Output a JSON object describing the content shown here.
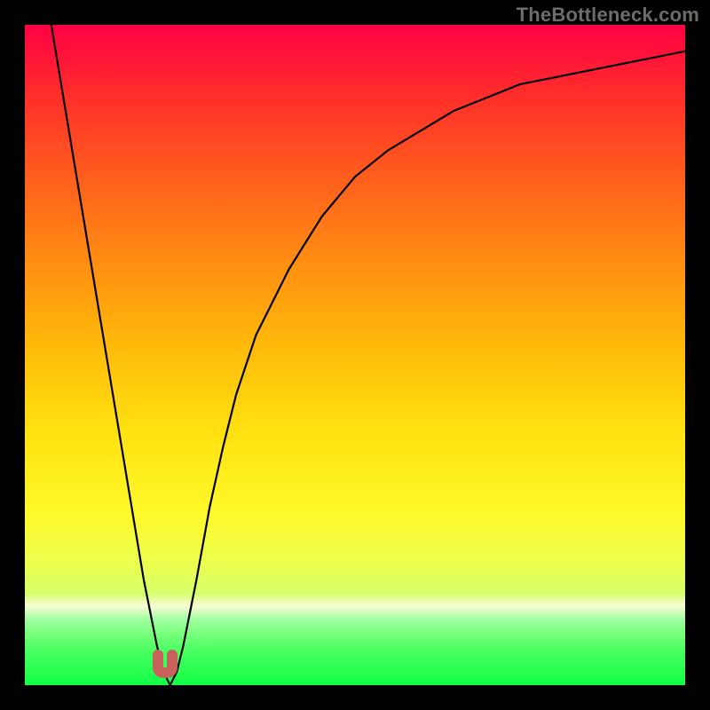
{
  "watermark": {
    "text": "TheBottleneck.com"
  },
  "colors": {
    "background": "#000000",
    "gradient_top": "#ff0044",
    "gradient_mid": "#ffe210",
    "gradient_bottom": "#12ff46",
    "curve": "#000000",
    "marker": "#c9615a"
  },
  "chart_data": {
    "type": "line",
    "title": "",
    "xlabel": "",
    "ylabel": "",
    "xlim": [
      0,
      100
    ],
    "ylim": [
      0,
      100
    ],
    "grid": false,
    "legend": null,
    "annotations": [],
    "series": [
      {
        "name": "curve",
        "x": [
          4,
          6,
          8,
          10,
          12,
          14,
          16,
          18,
          20,
          21,
          22,
          23,
          24,
          26,
          28,
          30,
          32,
          35,
          40,
          45,
          50,
          55,
          60,
          65,
          70,
          75,
          80,
          85,
          90,
          95,
          100
        ],
        "y": [
          100,
          88,
          76,
          64,
          52,
          40,
          28,
          16,
          6,
          2,
          0,
          2,
          6,
          16,
          27,
          36,
          44,
          53,
          63,
          71,
          77,
          81,
          84,
          87,
          89,
          91,
          92,
          93,
          94,
          95,
          96
        ]
      }
    ],
    "marker": {
      "x": 22,
      "y": 0,
      "shape": "u"
    }
  }
}
